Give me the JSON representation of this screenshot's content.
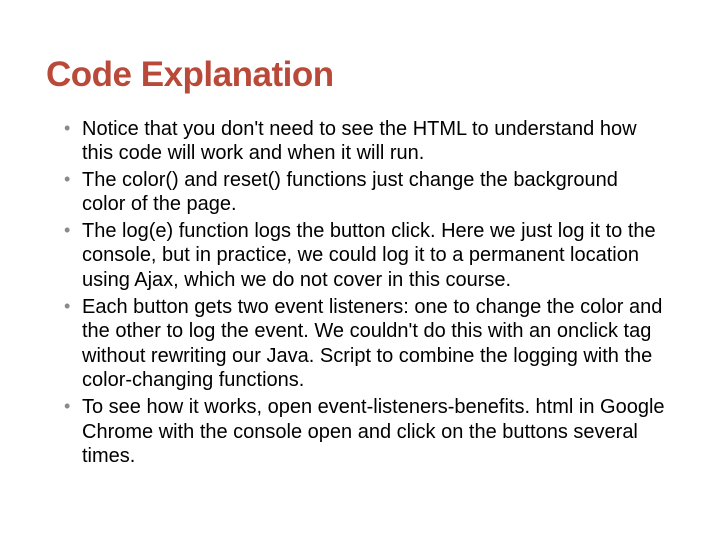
{
  "slide": {
    "title": "Code Explanation",
    "bullets": [
      "Notice that you don't need to see the HTML to understand how this code will work and when it will run.",
      "The color() and reset() functions just change the background color of the page.",
      "The log(e) function logs the button click. Here we just log it to the console, but in practice, we could log it to a permanent location using Ajax, which we do not cover in this course.",
      "Each button gets two event listeners: one to change the color and the other to log the event. We couldn't do this with an onclick tag without rewriting our Java. Script to combine the logging with the color-changing functions.",
      "To see how it works, open event-listeners-benefits. html in Google Chrome with the console open and click on the buttons several times."
    ]
  }
}
